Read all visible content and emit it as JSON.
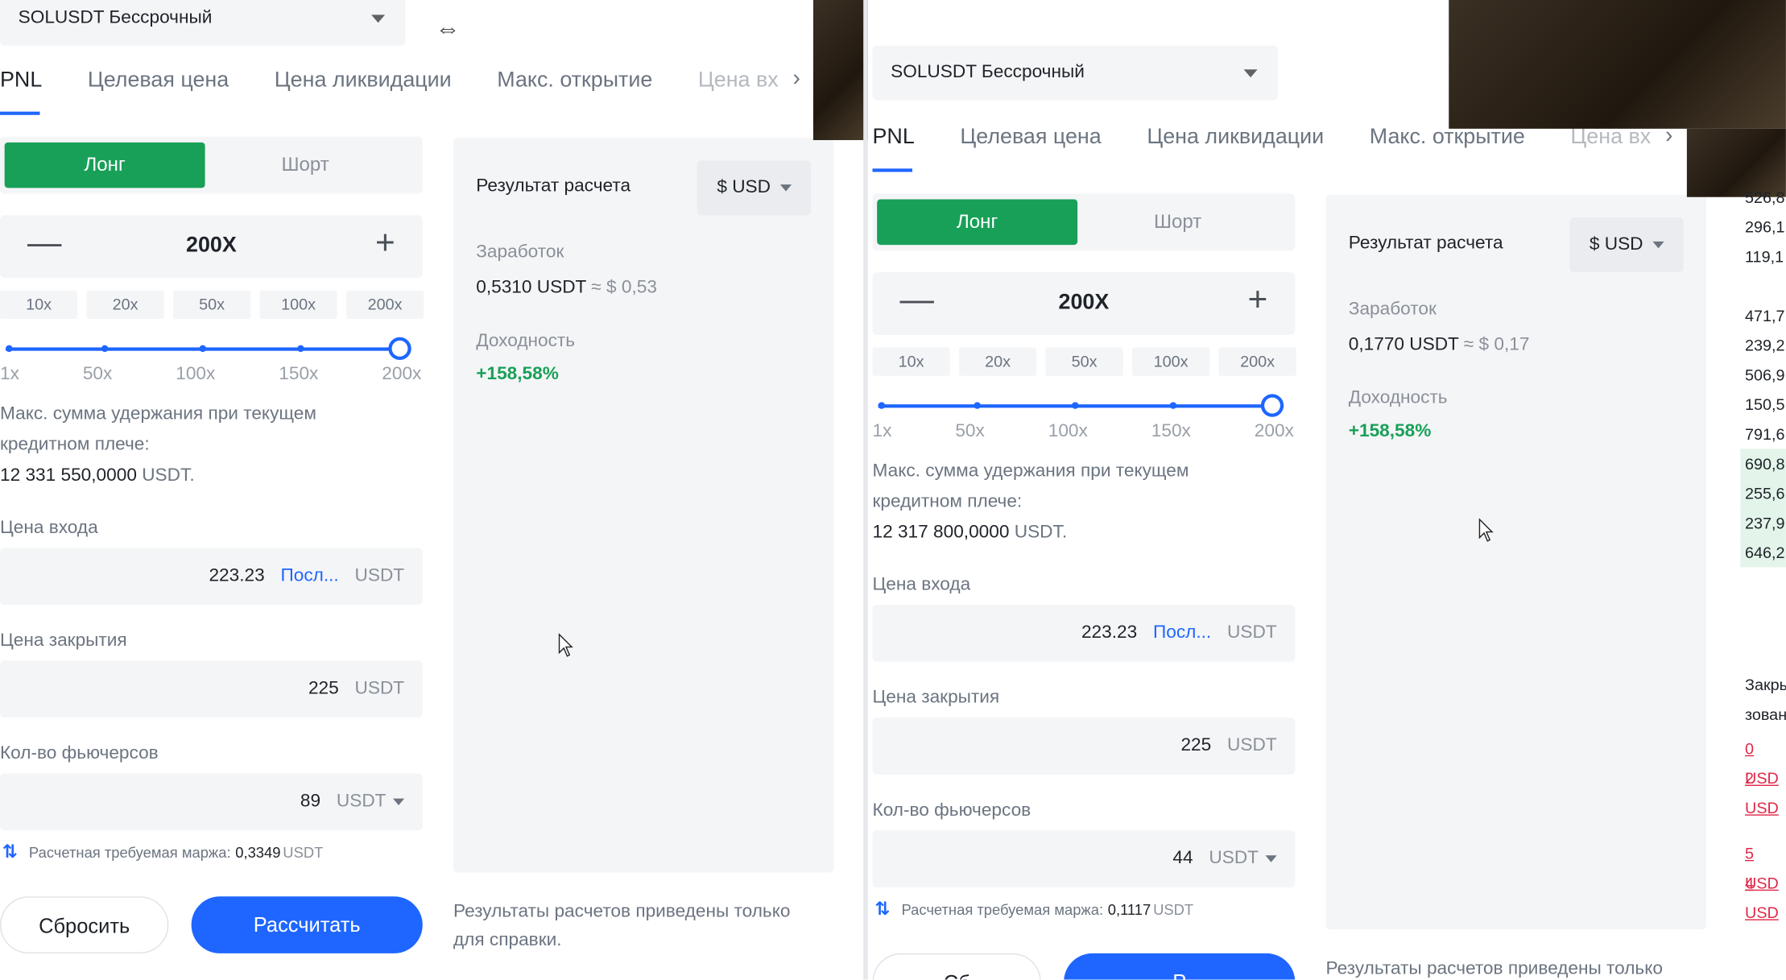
{
  "left": {
    "symbol": "SOLUSDT Бессрочный",
    "tabs": [
      "PNL",
      "Целевая цена",
      "Цена ликвидации",
      "Макс. открытие",
      "Цена вх"
    ],
    "side": {
      "long": "Лонг",
      "short": "Шорт"
    },
    "leverage": "200X",
    "chips": [
      "10x",
      "20x",
      "50x",
      "100x",
      "200x"
    ],
    "ticks": [
      "1x",
      "50x",
      "100x",
      "150x",
      "200x"
    ],
    "max_label_1": "Макс. сумма удержания при текущем",
    "max_label_2": "кредитном плече:",
    "max_value": "12 331 550,0000",
    "max_unit": "USDT.",
    "entry_label": "Цена входа",
    "entry_value": "223.23",
    "entry_link": "Посл...",
    "unit": "USDT",
    "close_label": "Цена закрытия",
    "close_value": "225",
    "qty_label": "Кол-во фьючерсов",
    "qty_value": "89",
    "margin_label": "Расчетная требуемая маржа:",
    "margin_value": "0,3349",
    "reset": "Сбросить",
    "calc": "Рассчитать",
    "result_title": "Результат расчета",
    "currency": "$ USD",
    "earn_label": "Заработок",
    "earn_value": "0,5310 USDT",
    "earn_approx": "≈ $ 0,53",
    "yield_label": "Доходность",
    "yield_value": "+158,58%",
    "note_1": "Результаты расчетов приведены только",
    "note_2": "для справки."
  },
  "right": {
    "symbol": "SOLUSDT Бессрочный",
    "tabs": [
      "PNL",
      "Целевая цена",
      "Цена ликвидации",
      "Макс. открытие",
      "Цена вх"
    ],
    "side": {
      "long": "Лонг",
      "short": "Шорт"
    },
    "leverage": "200X",
    "chips": [
      "10x",
      "20x",
      "50x",
      "100x",
      "200x"
    ],
    "ticks": [
      "1x",
      "50x",
      "100x",
      "150x",
      "200x"
    ],
    "max_label_1": "Макс. сумма удержания при текущем",
    "max_label_2": "кредитном плече:",
    "max_value": "12 317 800,0000",
    "max_unit": "USDT.",
    "entry_label": "Цена входа",
    "entry_value": "223.23",
    "entry_link": "Посл...",
    "unit": "USDT",
    "close_label": "Цена закрытия",
    "close_value": "225",
    "qty_label": "Кол-во фьючерсов",
    "qty_value": "44",
    "margin_label": "Расчетная требуемая маржа:",
    "margin_value": "0,1117",
    "reset": "Сб",
    "calc": "Р",
    "result_title": "Результат расчета",
    "currency": "$ USD",
    "earn_label": "Заработок",
    "earn_value": "0,1770 USDT",
    "earn_approx": "≈ $ 0,17",
    "yield_label": "Доходность",
    "yield_value": "+158,58%",
    "note_1": "Результаты расчетов приведены только"
  },
  "strip": {
    "values": [
      "526,8",
      "296,1",
      "119,1",
      "",
      "471,7",
      "239,2",
      "506,9",
      "150,5",
      "791,6",
      "690,8",
      "255,6",
      "237,9",
      "646,2"
    ],
    "close_label": "Закры",
    "used_label": "зовани",
    "usd": [
      "0 USD",
      "2 USD",
      "5 USD",
      "4 USD"
    ]
  },
  "colors": {
    "accent": "#1e66ff",
    "long": "#18a058",
    "panel_bg": "#f4f5f7"
  }
}
